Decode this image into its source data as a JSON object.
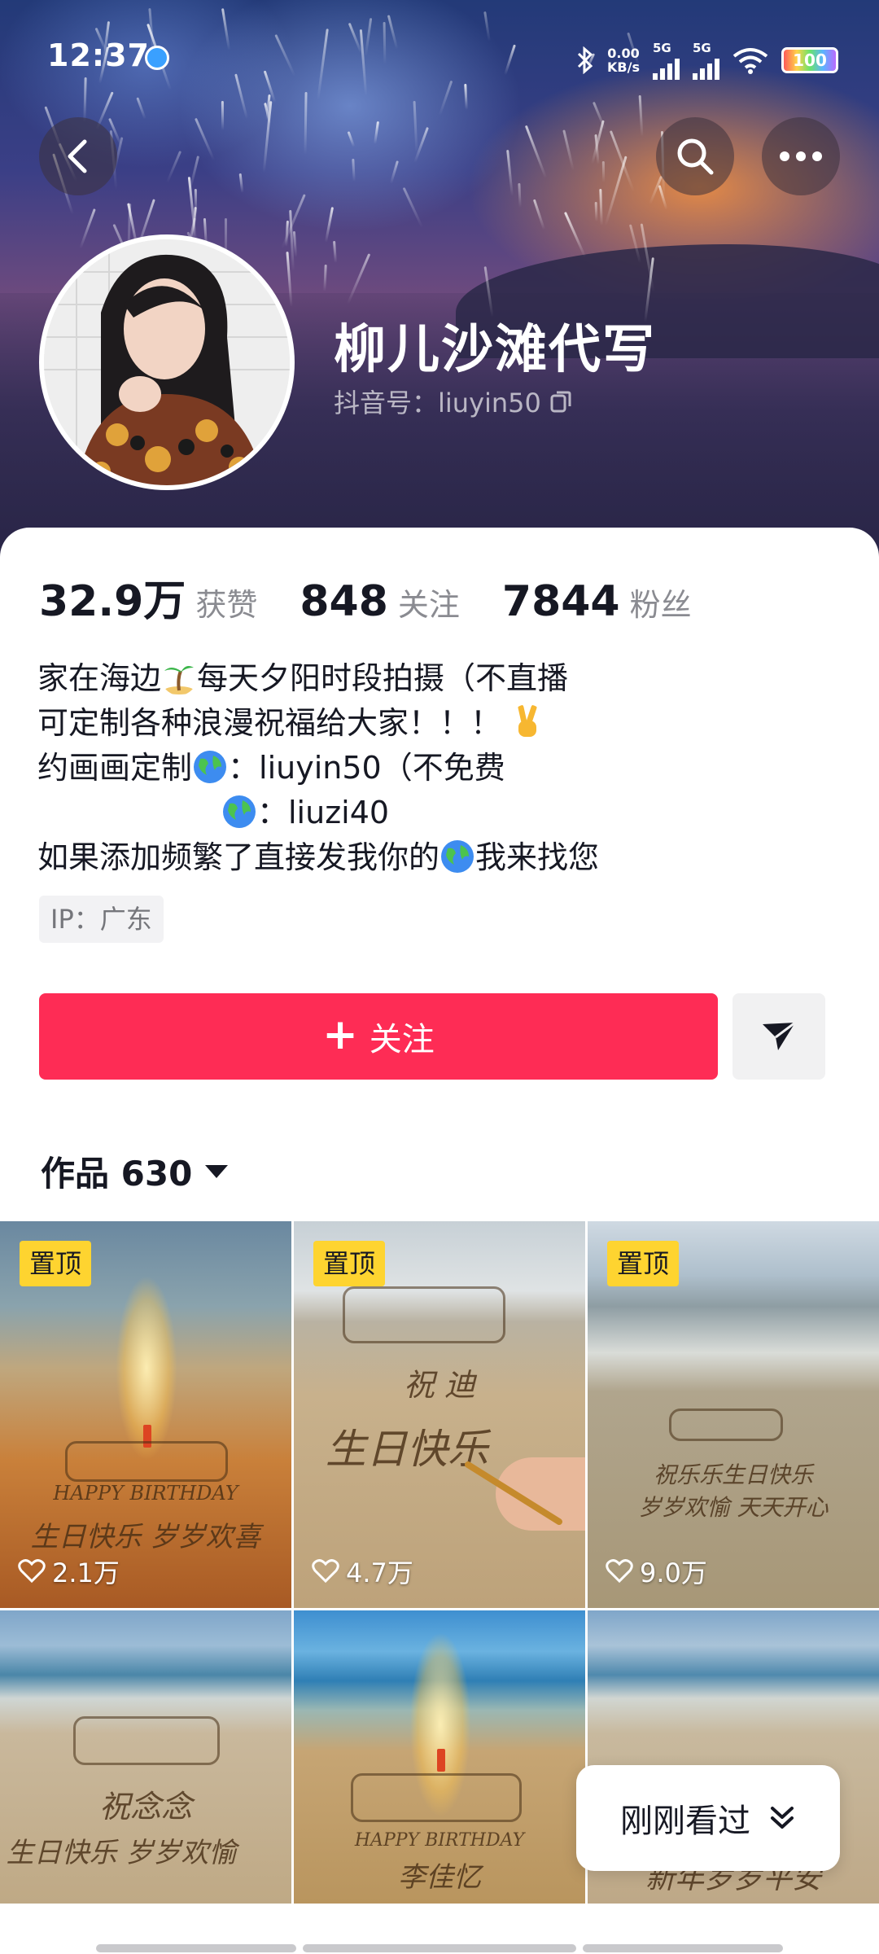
{
  "status_bar": {
    "time": "12:37",
    "net_speed_value": "0.00",
    "net_speed_unit": "KB/s",
    "sim1": "5G",
    "sim2": "5G",
    "battery": "100"
  },
  "profile": {
    "nickname": "柳儿沙滩代写",
    "douyin_id": "抖音号：liuyin50",
    "stats": [
      {
        "value": "32.9万",
        "label": "获赞"
      },
      {
        "value": "848",
        "label": "关注"
      },
      {
        "value": "7844",
        "label": "粉丝"
      }
    ],
    "bio": {
      "line1_a": "家在海边",
      "line1_b": "每天夕阳时段拍摄（不直播",
      "line2": "可定制各种浪漫祝福给大家！！！",
      "line3_a": "约画画定制",
      "line3_b": "：liuyin50（不免费",
      "line4": "：liuzi40",
      "line5_a": "如果添加频繁了直接发我你的",
      "line5_b": "我来找您"
    },
    "ip": "IP：广东"
  },
  "actions": {
    "follow_label": "关注",
    "follow_plus": "+",
    "accent_color": "#fe2c55"
  },
  "works": {
    "tab_label": "作品 630"
  },
  "videos": [
    {
      "pinned_label": "置顶",
      "likes": "2.1万",
      "sand_text_1": "HAPPY BIRTHDAY",
      "sand_text_2": "生日快乐 岁岁欢喜"
    },
    {
      "pinned_label": "置顶",
      "likes": "4.7万",
      "sand_text_1": "祝 迪",
      "sand_text_2": "生日快乐"
    },
    {
      "pinned_label": "置顶",
      "likes": "9.0万",
      "sand_text_1": "祝乐乐生日快乐",
      "sand_text_2": "岁岁欢愉 天天开心"
    },
    {
      "sand_text_1": "祝念念",
      "sand_text_2": "生日快乐 岁岁欢愉"
    },
    {
      "sand_text_1": "HAPPY BIRTHDAY",
      "sand_text_2": "李佳忆"
    },
    {
      "sand_text_1": "",
      "sand_text_2": "新年岁岁平安"
    }
  ],
  "recent": {
    "label": "刚刚看过"
  },
  "icons": {
    "back": "chevron-left-icon",
    "search": "search-icon",
    "more": "more-icon",
    "share": "send-icon",
    "copy": "copy-icon",
    "heart": "heart-icon",
    "double_chevron": "double-chevron-down-icon"
  }
}
